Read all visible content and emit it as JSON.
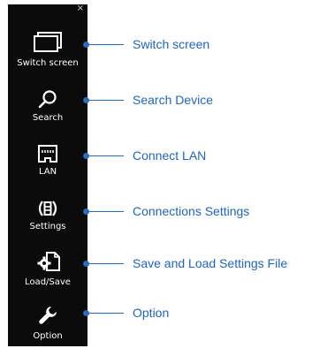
{
  "toolbar": {
    "close_glyph": "×",
    "items": [
      {
        "icon": "monitor-icon",
        "label": "Switch screen"
      },
      {
        "icon": "search-icon",
        "label": "Search"
      },
      {
        "icon": "lan-port-icon",
        "label": "LAN"
      },
      {
        "icon": "connections-settings-icon",
        "label": "Settings"
      },
      {
        "icon": "load-save-icon",
        "label": "Load/Save"
      },
      {
        "icon": "wrench-icon",
        "label": "Option"
      }
    ]
  },
  "callouts": [
    "Switch screen",
    "Search Device",
    "Connect LAN",
    "Connections Settings",
    "Save and Load Settings File",
    "Option"
  ],
  "colors": {
    "toolbar_bg": "#0b0b0b",
    "icon": "#ffffff",
    "callout": "#2d6ab5"
  }
}
